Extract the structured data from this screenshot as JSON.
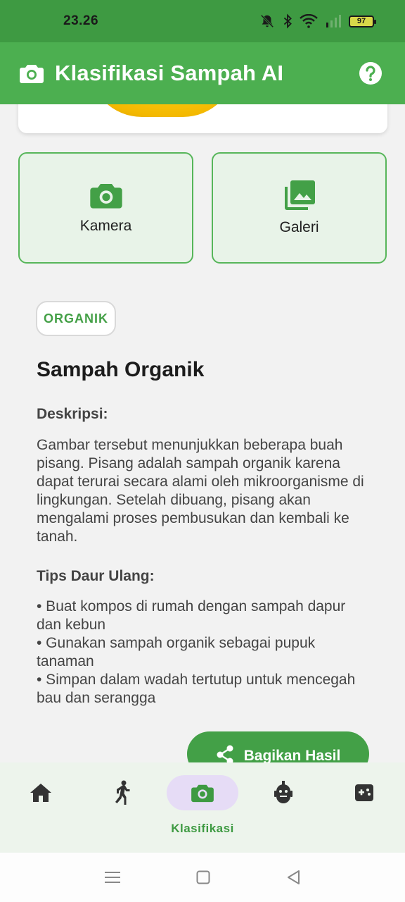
{
  "status_bar": {
    "time": "23.26",
    "battery": "97",
    "icons": [
      "silent-bell-icon",
      "bluetooth-icon",
      "wifi-icon",
      "signal-icon",
      "battery-icon"
    ]
  },
  "app_bar": {
    "title": "Klasifikasi Sampah AI",
    "icon": "camera-icon",
    "help_icon": "help-icon"
  },
  "source_buttons": [
    {
      "label": "Kamera",
      "icon": "camera-icon"
    },
    {
      "label": "Galeri",
      "icon": "photo-library-icon"
    }
  ],
  "result": {
    "badge": "ORGANIK",
    "title": "Sampah Organik",
    "description_heading": "Deskripsi:",
    "description": "Gambar tersebut menunjukkan beberapa buah pisang. Pisang adalah sampah organik karena dapat terurai secara alami oleh mikroorganisme di lingkungan.  Setelah dibuang, pisang akan mengalami proses pembusukan dan kembali ke tanah.",
    "tips_heading": "Tips Daur Ulang:",
    "tips": [
      "• Buat kompos di rumah dengan sampah dapur dan kebun",
      "• Gunakan sampah organik sebagai pupuk tanaman",
      "• Simpan dalam wadah tertutup untuk mencegah bau dan serangga"
    ],
    "share_label": "Bagikan Hasil"
  },
  "bottom_nav": {
    "items": [
      {
        "id": "home",
        "icon": "home-icon",
        "label": ""
      },
      {
        "id": "activity",
        "icon": "walking-icon",
        "label": ""
      },
      {
        "id": "klasifikasi",
        "icon": "camera-icon",
        "label": "Klasifikasi",
        "active": true
      },
      {
        "id": "robot",
        "icon": "robot-icon",
        "label": ""
      },
      {
        "id": "games",
        "icon": "gamepad-icon",
        "label": ""
      }
    ]
  },
  "colors": {
    "primary": "#4caf50",
    "status_bar": "#3e9a42",
    "accent_text": "#44a047",
    "active_pill": "#e6dcf6"
  }
}
